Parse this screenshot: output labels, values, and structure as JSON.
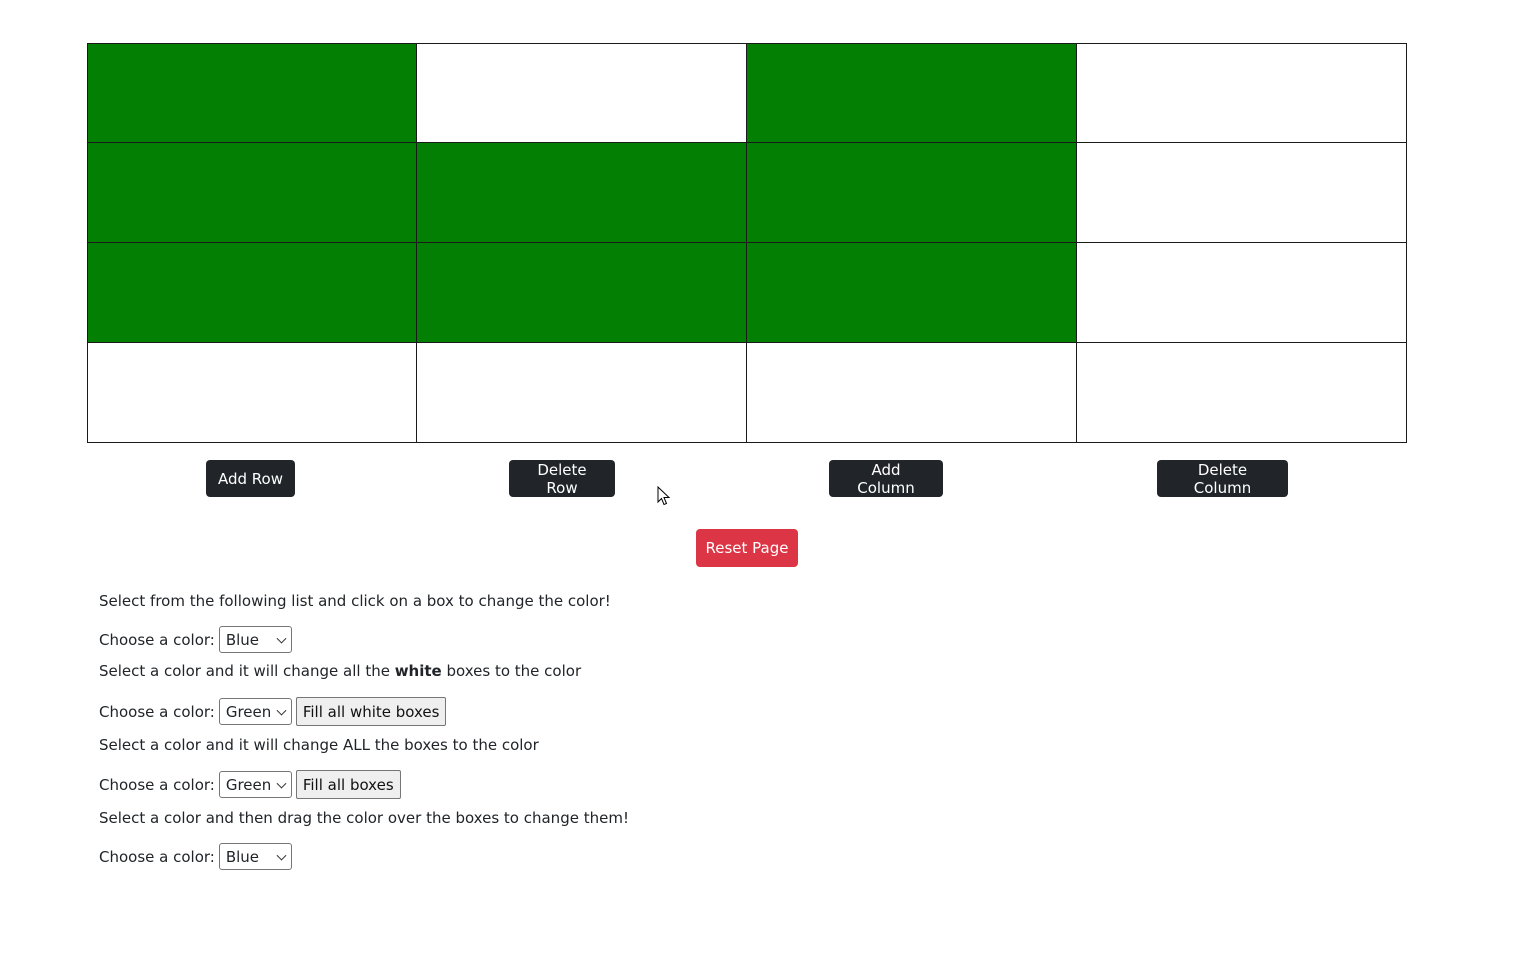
{
  "grid": {
    "columns": 4,
    "rows": [
      [
        "green",
        "white",
        "green",
        "white"
      ],
      [
        "green",
        "green",
        "green",
        "white"
      ],
      [
        "green",
        "green",
        "green",
        "white"
      ],
      [
        "white",
        "white",
        "white",
        "white"
      ]
    ],
    "colors": {
      "green": "#038003",
      "white": "#ffffff"
    }
  },
  "buttons": {
    "add_row": "Add Row",
    "delete_row": "Delete Row",
    "add_column": "Add Column",
    "delete_column": "Delete Column",
    "reset_page": "Reset Page"
  },
  "controls": {
    "instruction_click": "Select from the following list and click on a box to change the color!",
    "choose_label": "Choose a color:",
    "click_select_value": "Blue",
    "instruction_white_prefix": "Select a color and it will change all the ",
    "instruction_white_bold": "white",
    "instruction_white_suffix": " boxes to the color",
    "white_select_value": "Green",
    "fill_white_label": "Fill all white boxes",
    "instruction_all": "Select a color and it will change ALL the boxes to the color",
    "all_select_value": "Green",
    "fill_all_label": "Fill all boxes",
    "instruction_drag": "Select a color and then drag the color over the boxes to change them!",
    "drag_select_value": "Blue"
  },
  "icons": {
    "dropdown": "chevron-down-icon",
    "cursor": "mouse-pointer-icon"
  },
  "accent_colors": {
    "dark_button": "#212529",
    "reset_button": "#dc3545"
  }
}
